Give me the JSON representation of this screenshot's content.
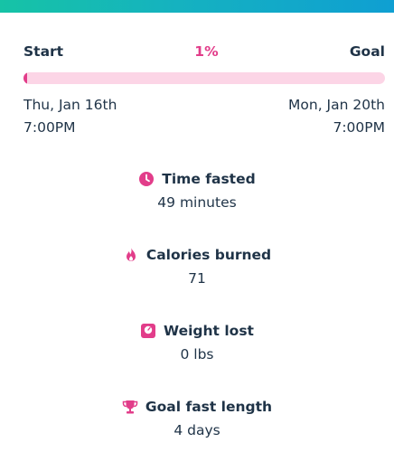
{
  "progress": {
    "start_label": "Start",
    "percent_label": "1%",
    "goal_label": "Goal",
    "fraction": 0.01
  },
  "dates": {
    "start_day": "Thu, Jan 16th",
    "start_time": "7:00PM",
    "goal_day": "Mon, Jan 20th",
    "goal_time": "7:00PM"
  },
  "stats": {
    "time_fasted": {
      "label": "Time fasted",
      "value": "49 minutes",
      "icon": "clock-icon"
    },
    "calories": {
      "label": "Calories burned",
      "value": "71",
      "icon": "flame-icon"
    },
    "weight": {
      "label": "Weight lost",
      "value": "0 lbs",
      "icon": "scale-icon"
    },
    "goal_length": {
      "label": "Goal fast length",
      "value": "4 days",
      "icon": "trophy-icon"
    }
  },
  "colors": {
    "accent": "#e23d8a",
    "track": "#fcd5e6",
    "text": "#1f3347",
    "header_gradient_start": "#16c3a6",
    "header_gradient_end": "#0f9fd2"
  }
}
